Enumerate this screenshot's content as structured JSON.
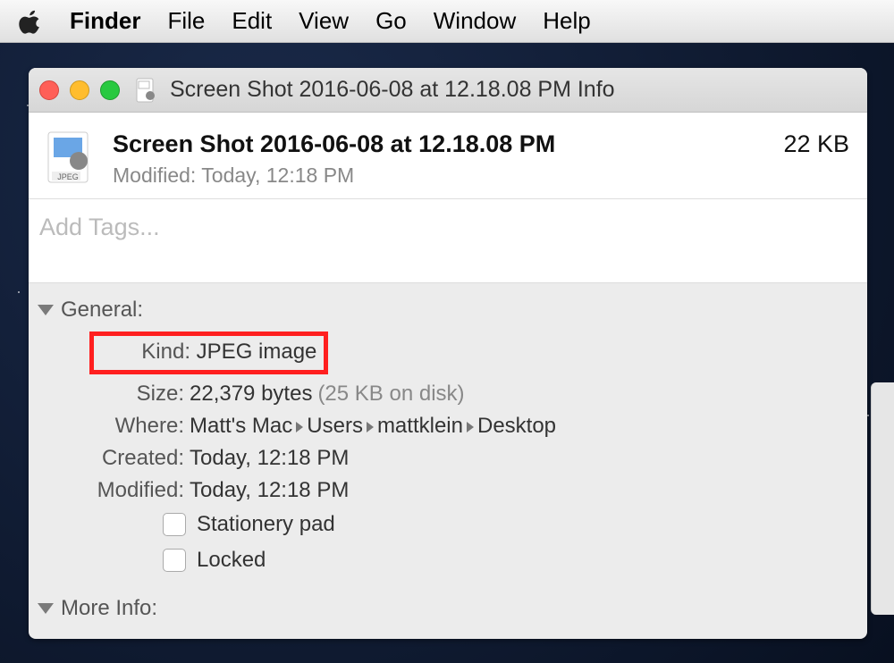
{
  "menubar": {
    "app": "Finder",
    "items": [
      "File",
      "Edit",
      "View",
      "Go",
      "Window",
      "Help"
    ]
  },
  "window": {
    "title": "Screen Shot 2016-06-08 at 12.18.08 PM Info"
  },
  "header": {
    "filename": "Screen Shot 2016-06-08 at 12.18.08 PM",
    "modified": "Modified: Today, 12:18 PM",
    "filesize": "22 KB",
    "preview_label": "JPEG"
  },
  "tags": {
    "placeholder": "Add Tags..."
  },
  "general": {
    "label": "General:",
    "kind": {
      "k": "Kind:",
      "v": "JPEG image"
    },
    "size": {
      "k": "Size:",
      "v": "22,379 bytes",
      "suffix": "(25 KB on disk)"
    },
    "where": {
      "k": "Where:",
      "path": [
        "Matt's Mac",
        "Users",
        "mattklein",
        "Desktop"
      ]
    },
    "created": {
      "k": "Created:",
      "v": "Today, 12:18 PM"
    },
    "modified": {
      "k": "Modified:",
      "v": "Today, 12:18 PM"
    },
    "stationery": "Stationery pad",
    "locked": "Locked"
  },
  "more_info": {
    "label": "More Info:"
  }
}
